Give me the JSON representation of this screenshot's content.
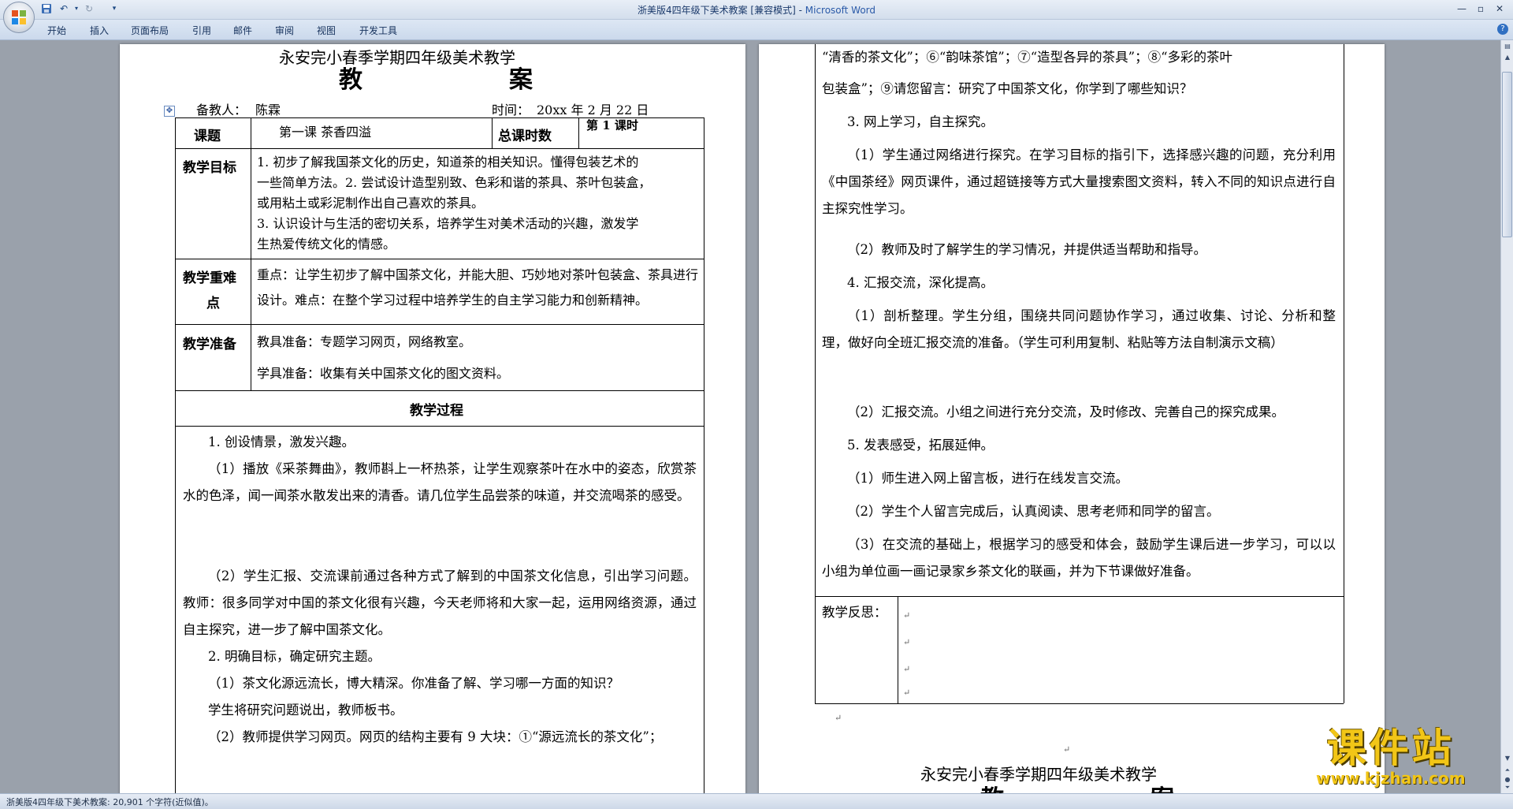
{
  "window": {
    "title": "浙美版4四年级下美术教案 [兼容模式]",
    "app_name": "Microsoft Word",
    "separator": " - "
  },
  "ribbon": {
    "tabs": [
      "开始",
      "插入",
      "页面布局",
      "引用",
      "邮件",
      "审阅",
      "视图",
      "开发工具"
    ]
  },
  "page1": {
    "title": "永安完小春季学期四年级美术教学",
    "title_big_left": "教",
    "title_big_right": "案",
    "teacher_label": "备教人：",
    "teacher_name": "陈霖",
    "time_label": "时间：",
    "time_value": "20xx 年 2 月 22 日",
    "table": {
      "topic_label": "课题",
      "topic_value": "第一课  茶香四溢",
      "total_hours_label": "总课时数",
      "hours_value": "第   1   课时",
      "goals_label": "教学目标",
      "goals_lines": [
        "1. 初步了解我国茶文化的历史，知道茶的相关知识。懂得包装艺术的",
        "一些简单方法。2. 尝试设计造型别致、色彩和谐的茶具、茶叶包装盒，",
        "或用粘土或彩泥制作出自己喜欢的茶具。",
        "3. 认识设计与生活的密切关系，培养学生对美术活动的兴趣，激发学",
        "生热爱传统文化的情感。"
      ],
      "difficulty_label_1": "教学重难",
      "difficulty_label_2": "点",
      "difficulty_lines": [
        "重点：让学生初步了解中国茶文化，并能大胆、巧妙地对茶叶包装盒、茶具进行",
        "设计。难点：在整个学习过程中培养学生的自主学习能力和创新精神。"
      ],
      "prep_label": "教学准备",
      "prep_teacher": "教具准备：专题学习网页，网络教室。",
      "prep_student": "学具准备：收集有关中国茶文化的图文资料。",
      "process_label": "教学过程"
    },
    "process_paragraphs": [
      "1. 创设情景，激发兴趣。",
      "（1）播放《采茶舞曲》，教师斟上一杯热茶，让学生观察茶叶在水中的姿态，欣赏茶水的色泽，闻一闻茶水散发出来的清香。请几位学生品尝茶的味道，并交流喝茶的感受。",
      "（2）学生汇报、交流课前通过各种方式了解到的中国茶文化信息，引出学习问题。教师：很多同学对中国的茶文化很有兴趣，今天老师将和大家一起，运用网络资源，通过自主探究，进一步了解中国茶文化。",
      "2. 明确目标，确定研究主题。",
      "（1）茶文化源远流长，博大精深。你准备了解、学习哪一方面的知识？",
      "学生将研究问题说出，教师板书。",
      "（2）教师提供学习网页。网页的结构主要有 9 大块：①“源远流长的茶文化”；"
    ]
  },
  "page2": {
    "continuation_lines": [
      "“清香的茶文化”；⑥“韵味茶馆”；⑦“造型各异的茶具”；⑧“多彩的茶叶",
      "包装盒”；⑨请您留言：研究了中国茶文化，你学到了哪些知识？"
    ],
    "paragraphs": [
      "3. 网上学习，自主探究。",
      "（1）学生通过网络进行探究。在学习目标的指引下，选择感兴趣的问题，充分利用《中国茶经》网页课件，通过超链接等方式大量搜索图文资料，转入不同的知识点进行自主探究性学习。",
      "（2）教师及时了解学生的学习情况，并提供适当帮助和指导。",
      "4. 汇报交流，深化提高。",
      "（1）剖析整理。学生分组，围绕共同问题协作学习，通过收集、讨论、分析和整理，做好向全班汇报交流的准备。（学生可利用复制、粘贴等方法自制演示文稿）",
      "（2）汇报交流。小组之间进行充分交流，及时修改、完善自己的探究成果。",
      "5. 发表感受，拓展延伸。",
      "（1）师生进入网上留言板，进行在线发言交流。",
      "（2）学生个人留言完成后，认真阅读、思考老师和同学的留言。",
      "（3）在交流的基础上，根据学习的感受和体会，鼓励学生课后进一步学习，可以以小组为单位画一画记录家乡茶文化的联画，并为下节课做好准备。"
    ],
    "reflection_label": "教学反思：",
    "next_title": "永安完小春季学期四年级美术教学",
    "next_big_left": "教",
    "next_big_right": "案"
  },
  "statusbar": {
    "text": "浙美版4四年级下美术教案: 20,901 个字符(近似值)。"
  },
  "watermark": {
    "main": "课件站",
    "url": "www.kjzhan.com"
  },
  "icons": [
    "office-button-icon",
    "save-icon",
    "undo-icon",
    "redo-icon",
    "minimize-icon",
    "maximize-icon",
    "close-icon",
    "help-icon",
    "table-move-handle-icon"
  ]
}
